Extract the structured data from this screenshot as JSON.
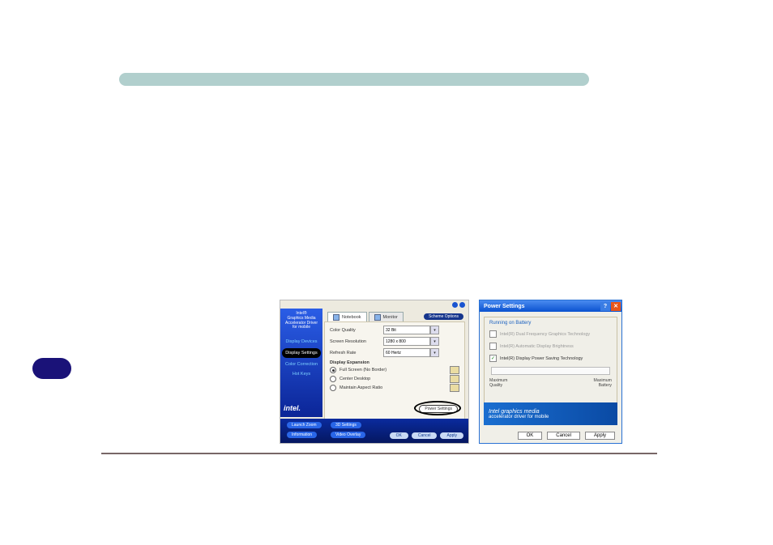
{
  "left_dialog": {
    "brand_lines": [
      "Intel®",
      "Graphics Media",
      "Accelerator Driver",
      "for mobile"
    ],
    "side_menu": {
      "item0": "Display Devices",
      "item1": "Display Settings",
      "item2": "Color Correction",
      "item3": "Hot Keys"
    },
    "intel_logo": "intel.",
    "tabs": {
      "notebook": "Notebook",
      "monitor": "Monitor"
    },
    "scheme_btn": "Scheme Options",
    "fields": {
      "color_quality_label": "Color Quality",
      "color_quality_value": "32 Bit",
      "resolution_label": "Screen Resolution",
      "resolution_value": "1280 x 800",
      "refresh_label": "Refresh Rate",
      "refresh_value": "60 Hertz"
    },
    "expansion": {
      "title": "Display Expansion",
      "opt0": "Full Screen (No Border)",
      "opt1": "Center Desktop",
      "opt2": "Maintain Aspect Ratio"
    },
    "power_settings_btn": "Power Settings",
    "bottom": {
      "launch_zoom": "Launch Zoom",
      "settings_3d": "3D Settings",
      "information": "Information",
      "video_overlay": "Video Overlay",
      "ok": "OK",
      "cancel": "Cancel",
      "apply": "Apply"
    }
  },
  "right_dialog": {
    "title": "Power Settings",
    "pane_heading": "Running on Battery",
    "chk0": "Intel(R) Dual Frequency Graphics Technology",
    "chk1": "Intel(R) Automatic Display Brightness",
    "chk2": "Intel(R) Display Power Saving Technology",
    "slider_left_top": "Maximum",
    "slider_left_bot": "Quality",
    "slider_right_top": "Maximum",
    "slider_right_bot": "Battery",
    "logo_l1": "Intel",
    "logo_l2": "graphics media",
    "logo_l3": "accelerator driver for mobile",
    "ok": "OK",
    "cancel": "Cancel",
    "apply": "Apply"
  }
}
